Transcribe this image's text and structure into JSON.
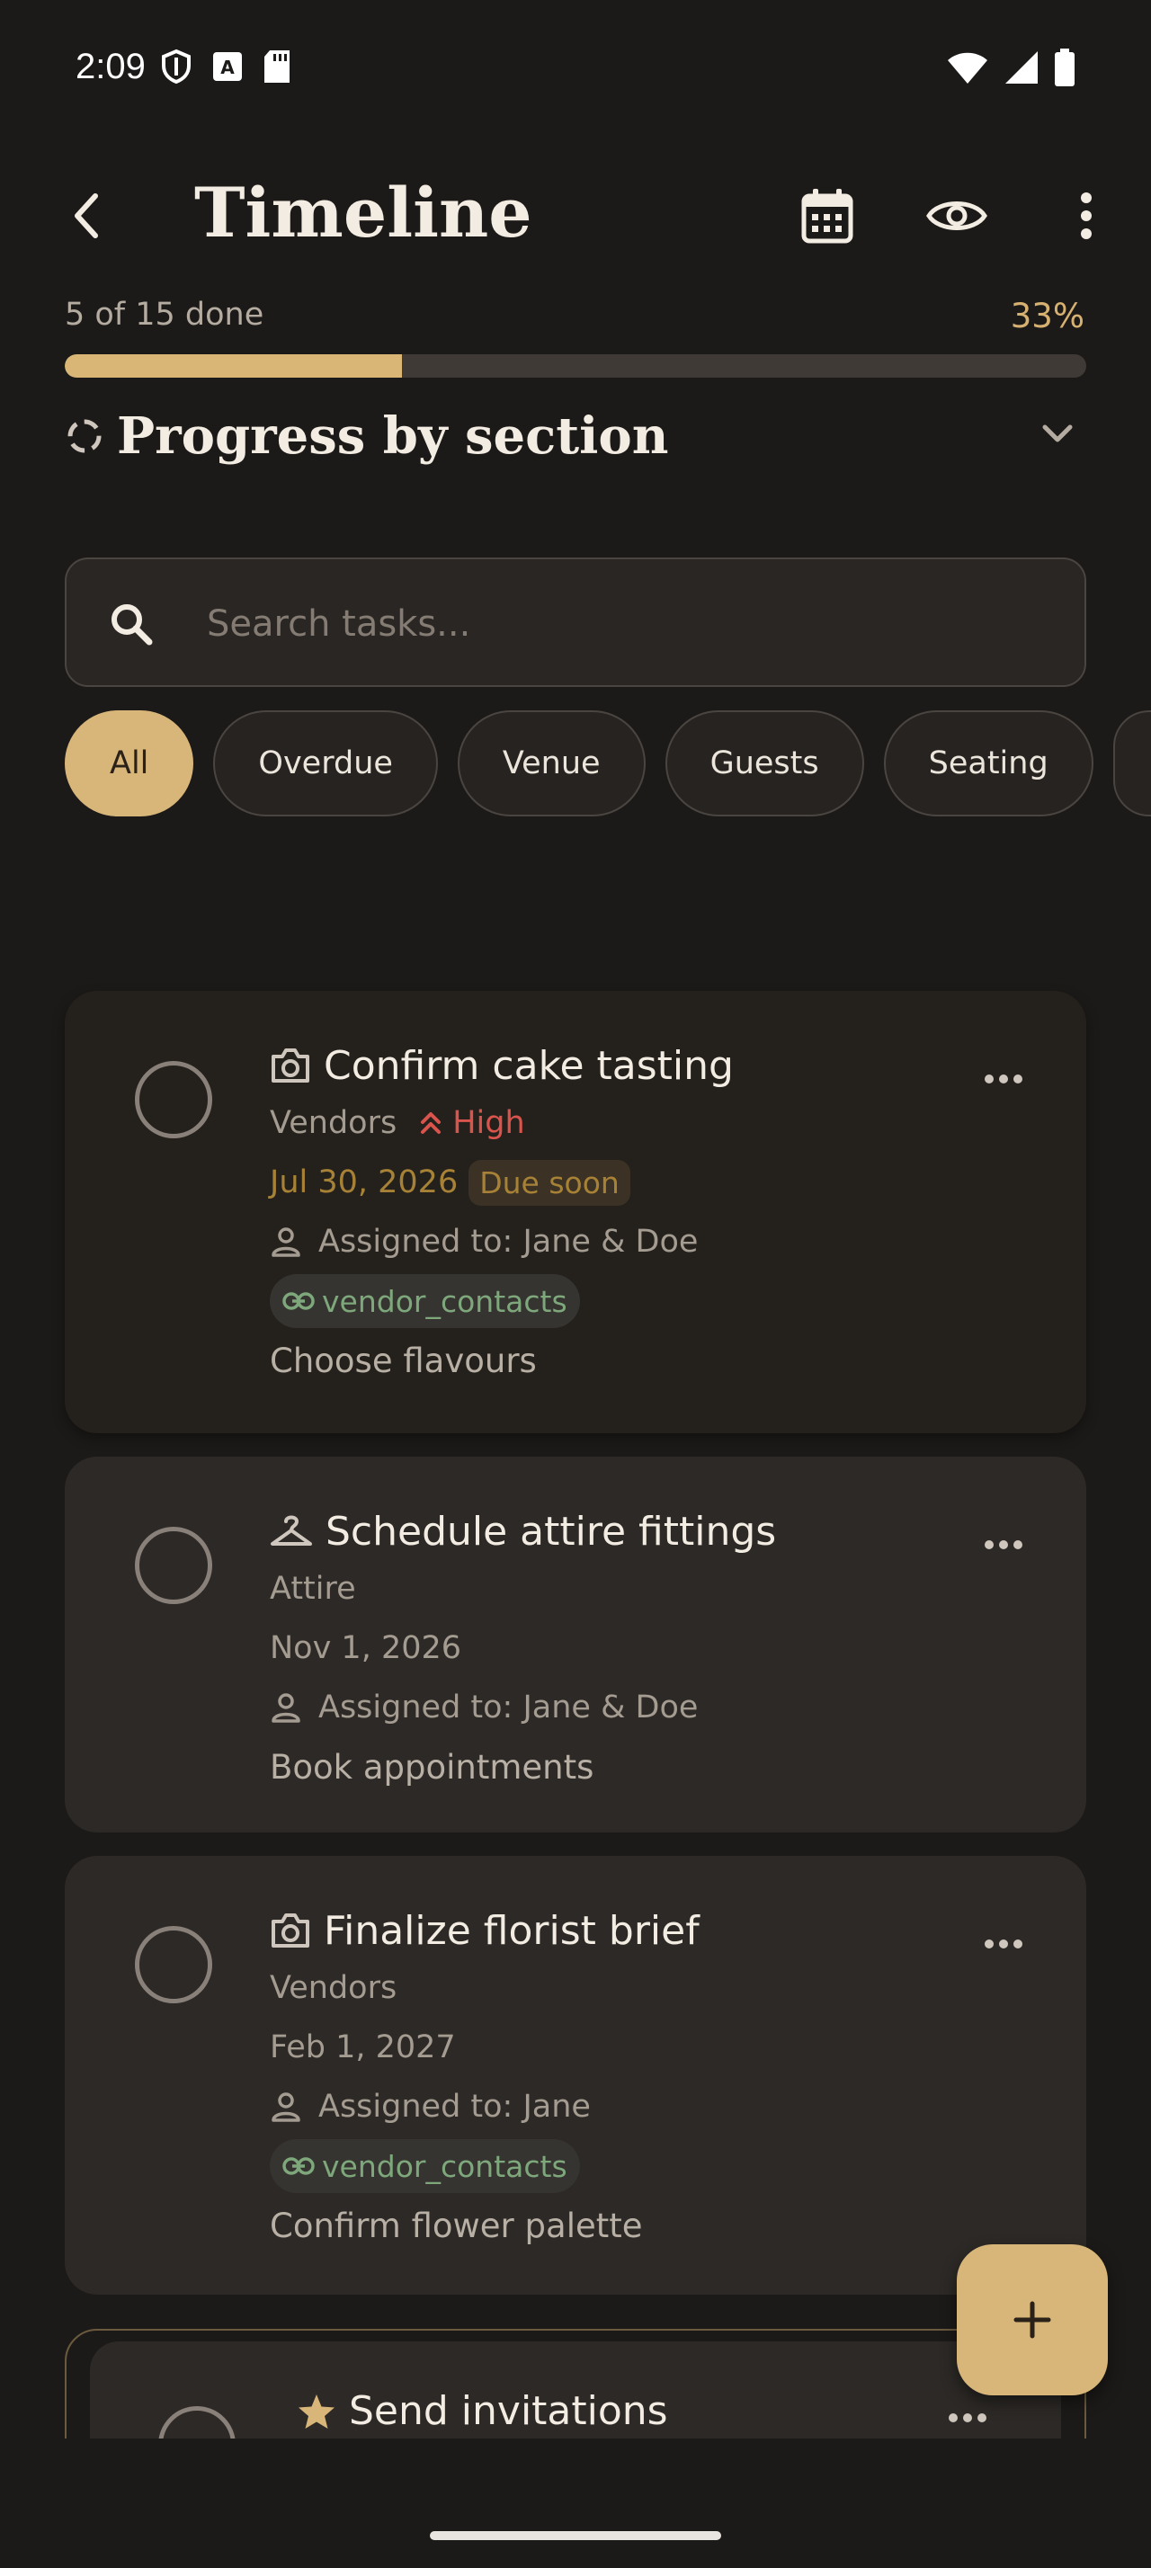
{
  "status_bar": {
    "time": "2:09"
  },
  "app_bar": {
    "title": "Timeline"
  },
  "progress": {
    "text": "5 of 15 done",
    "percent_label": "33%",
    "fraction": 0.33
  },
  "section": {
    "title": "Progress by section"
  },
  "search": {
    "placeholder": "Search tasks..."
  },
  "filters": [
    "All",
    "Overdue",
    "Venue",
    "Guests",
    "Seating"
  ],
  "tasks": [
    {
      "title": "Confirm cake tasting",
      "icon": "camera-icon",
      "category": "Vendors",
      "priority": "High",
      "date": "Jul 30, 2026",
      "due_badge": "Due soon",
      "assigned": "Assigned to: Jane & Doe",
      "link": "vendor_contacts",
      "note": "Choose flavours"
    },
    {
      "title": "Schedule attire fittings",
      "icon": "hanger-icon",
      "category": "Attire",
      "date": "Nov 1, 2026",
      "assigned": "Assigned to: Jane & Doe",
      "note": "Book appointments"
    },
    {
      "title": "Finalize florist brief",
      "icon": "camera-icon",
      "category": "Vendors",
      "date": "Feb 1, 2027",
      "assigned": "Assigned to: Jane",
      "link": "vendor_contacts",
      "note": "Confirm flower palette"
    },
    {
      "title": "Send invitations",
      "icon": "star-icon"
    }
  ],
  "colors": {
    "background": "#1c1a18",
    "accent": "#d8b679",
    "high_priority": "#d9544d",
    "due_soon": "#a78236",
    "link": "#7ea77c"
  }
}
